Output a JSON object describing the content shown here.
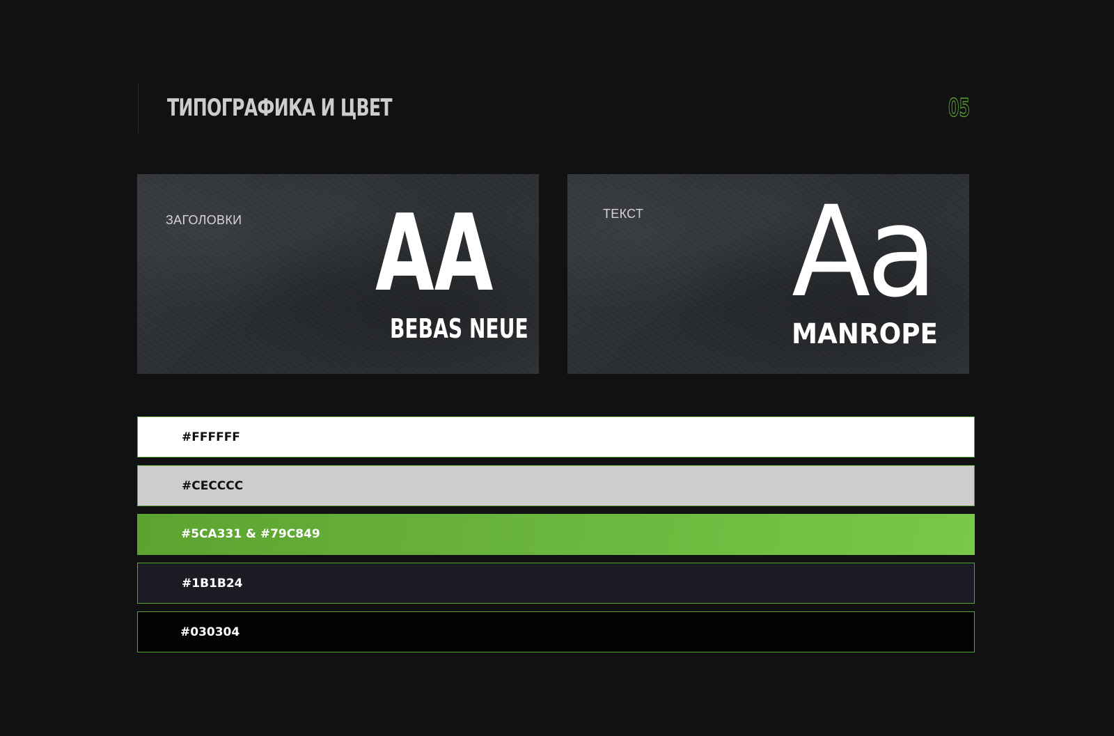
{
  "header": {
    "title": "ТИПОГРАФИКА И ЦВЕТ",
    "page_number": "05"
  },
  "typography": {
    "headings": {
      "label": "ЗАГОЛОВКИ",
      "sample": "AA",
      "font_name": "BEBAS NEUE"
    },
    "text": {
      "label": "ТЕКСТ",
      "sample": "Aa",
      "font_name": "MANROPE"
    }
  },
  "colors": {
    "accent": "#5CA331",
    "swatches": [
      {
        "label": "#FFFFFF",
        "fill": "#FFFFFF",
        "text_color": "#111111"
      },
      {
        "label": "#CECCCC",
        "fill": "#CECCCC",
        "text_color": "#111111"
      },
      {
        "label": "#5CA331 & #79C849",
        "fill": "#5CA331",
        "fill_end": "#79C849",
        "text_color": "#FFFFFF"
      },
      {
        "label": "#1B1B24",
        "fill": "#1B1B24",
        "text_color": "#FFFFFF"
      },
      {
        "label": "#030304",
        "fill": "#030304",
        "text_color": "#FFFFFF"
      }
    ]
  }
}
